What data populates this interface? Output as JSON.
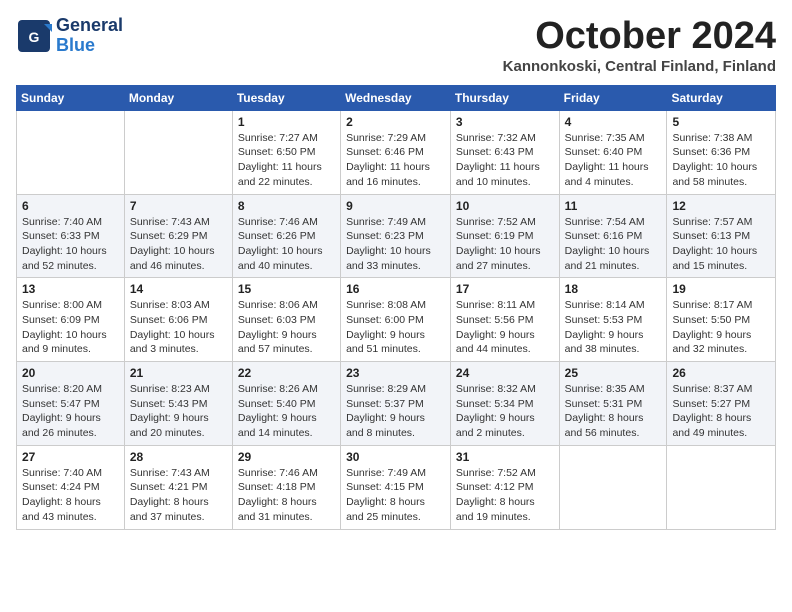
{
  "logo": {
    "line1": "General",
    "line2": "Blue"
  },
  "title": "October 2024",
  "location": "Kannonkoski, Central Finland, Finland",
  "weekdays": [
    "Sunday",
    "Monday",
    "Tuesday",
    "Wednesday",
    "Thursday",
    "Friday",
    "Saturday"
  ],
  "weeks": [
    [
      {
        "day": "",
        "content": ""
      },
      {
        "day": "",
        "content": ""
      },
      {
        "day": "1",
        "content": "Sunrise: 7:27 AM\nSunset: 6:50 PM\nDaylight: 11 hours\nand 22 minutes."
      },
      {
        "day": "2",
        "content": "Sunrise: 7:29 AM\nSunset: 6:46 PM\nDaylight: 11 hours\nand 16 minutes."
      },
      {
        "day": "3",
        "content": "Sunrise: 7:32 AM\nSunset: 6:43 PM\nDaylight: 11 hours\nand 10 minutes."
      },
      {
        "day": "4",
        "content": "Sunrise: 7:35 AM\nSunset: 6:40 PM\nDaylight: 11 hours\nand 4 minutes."
      },
      {
        "day": "5",
        "content": "Sunrise: 7:38 AM\nSunset: 6:36 PM\nDaylight: 10 hours\nand 58 minutes."
      }
    ],
    [
      {
        "day": "6",
        "content": "Sunrise: 7:40 AM\nSunset: 6:33 PM\nDaylight: 10 hours\nand 52 minutes."
      },
      {
        "day": "7",
        "content": "Sunrise: 7:43 AM\nSunset: 6:29 PM\nDaylight: 10 hours\nand 46 minutes."
      },
      {
        "day": "8",
        "content": "Sunrise: 7:46 AM\nSunset: 6:26 PM\nDaylight: 10 hours\nand 40 minutes."
      },
      {
        "day": "9",
        "content": "Sunrise: 7:49 AM\nSunset: 6:23 PM\nDaylight: 10 hours\nand 33 minutes."
      },
      {
        "day": "10",
        "content": "Sunrise: 7:52 AM\nSunset: 6:19 PM\nDaylight: 10 hours\nand 27 minutes."
      },
      {
        "day": "11",
        "content": "Sunrise: 7:54 AM\nSunset: 6:16 PM\nDaylight: 10 hours\nand 21 minutes."
      },
      {
        "day": "12",
        "content": "Sunrise: 7:57 AM\nSunset: 6:13 PM\nDaylight: 10 hours\nand 15 minutes."
      }
    ],
    [
      {
        "day": "13",
        "content": "Sunrise: 8:00 AM\nSunset: 6:09 PM\nDaylight: 10 hours\nand 9 minutes."
      },
      {
        "day": "14",
        "content": "Sunrise: 8:03 AM\nSunset: 6:06 PM\nDaylight: 10 hours\nand 3 minutes."
      },
      {
        "day": "15",
        "content": "Sunrise: 8:06 AM\nSunset: 6:03 PM\nDaylight: 9 hours\nand 57 minutes."
      },
      {
        "day": "16",
        "content": "Sunrise: 8:08 AM\nSunset: 6:00 PM\nDaylight: 9 hours\nand 51 minutes."
      },
      {
        "day": "17",
        "content": "Sunrise: 8:11 AM\nSunset: 5:56 PM\nDaylight: 9 hours\nand 44 minutes."
      },
      {
        "day": "18",
        "content": "Sunrise: 8:14 AM\nSunset: 5:53 PM\nDaylight: 9 hours\nand 38 minutes."
      },
      {
        "day": "19",
        "content": "Sunrise: 8:17 AM\nSunset: 5:50 PM\nDaylight: 9 hours\nand 32 minutes."
      }
    ],
    [
      {
        "day": "20",
        "content": "Sunrise: 8:20 AM\nSunset: 5:47 PM\nDaylight: 9 hours\nand 26 minutes."
      },
      {
        "day": "21",
        "content": "Sunrise: 8:23 AM\nSunset: 5:43 PM\nDaylight: 9 hours\nand 20 minutes."
      },
      {
        "day": "22",
        "content": "Sunrise: 8:26 AM\nSunset: 5:40 PM\nDaylight: 9 hours\nand 14 minutes."
      },
      {
        "day": "23",
        "content": "Sunrise: 8:29 AM\nSunset: 5:37 PM\nDaylight: 9 hours\nand 8 minutes."
      },
      {
        "day": "24",
        "content": "Sunrise: 8:32 AM\nSunset: 5:34 PM\nDaylight: 9 hours\nand 2 minutes."
      },
      {
        "day": "25",
        "content": "Sunrise: 8:35 AM\nSunset: 5:31 PM\nDaylight: 8 hours\nand 56 minutes."
      },
      {
        "day": "26",
        "content": "Sunrise: 8:37 AM\nSunset: 5:27 PM\nDaylight: 8 hours\nand 49 minutes."
      }
    ],
    [
      {
        "day": "27",
        "content": "Sunrise: 7:40 AM\nSunset: 4:24 PM\nDaylight: 8 hours\nand 43 minutes."
      },
      {
        "day": "28",
        "content": "Sunrise: 7:43 AM\nSunset: 4:21 PM\nDaylight: 8 hours\nand 37 minutes."
      },
      {
        "day": "29",
        "content": "Sunrise: 7:46 AM\nSunset: 4:18 PM\nDaylight: 8 hours\nand 31 minutes."
      },
      {
        "day": "30",
        "content": "Sunrise: 7:49 AM\nSunset: 4:15 PM\nDaylight: 8 hours\nand 25 minutes."
      },
      {
        "day": "31",
        "content": "Sunrise: 7:52 AM\nSunset: 4:12 PM\nDaylight: 8 hours\nand 19 minutes."
      },
      {
        "day": "",
        "content": ""
      },
      {
        "day": "",
        "content": ""
      }
    ]
  ]
}
